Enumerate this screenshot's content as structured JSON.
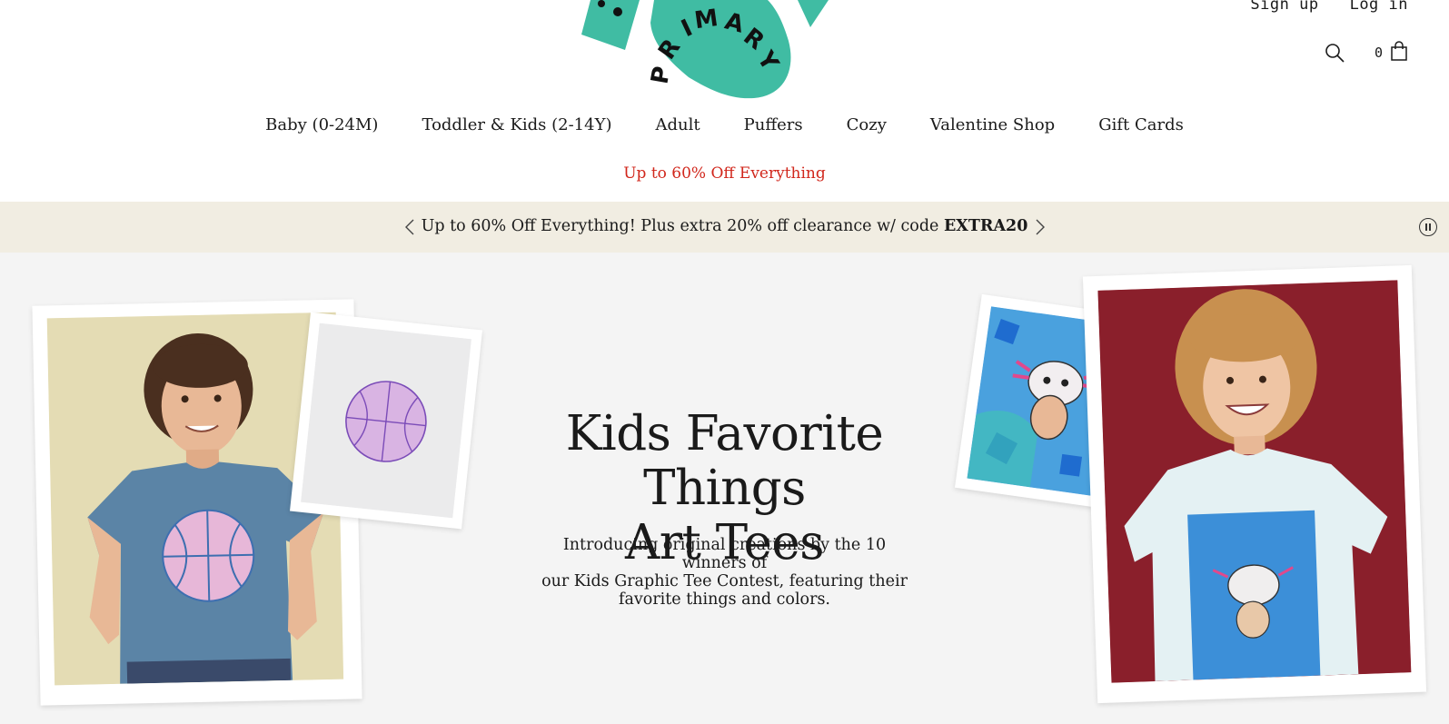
{
  "brand": {
    "logo_text": "PRIMARY",
    "logo_color": "#40bca3"
  },
  "account": {
    "signup": "Sign up",
    "login": "Log in"
  },
  "cart": {
    "count": "0"
  },
  "nav": [
    {
      "label": "Baby (0-24M)"
    },
    {
      "label": "Toddler & Kids (2-14Y)"
    },
    {
      "label": "Adult"
    },
    {
      "label": "Puffers"
    },
    {
      "label": "Cozy"
    },
    {
      "label": "Valentine Shop"
    },
    {
      "label": "Gift Cards"
    }
  ],
  "promo_link": "Up to 60% Off Everything",
  "announcement": {
    "text": "Up to 60% Off Everything! Plus extra 20% off clearance w/ code ",
    "code": "EXTRA20",
    "background": "#f1ede2"
  },
  "hero": {
    "title_line1": "Kids Favorite Things",
    "title_line2": "Art Tees",
    "subtitle_line1": "Introducing original creations by the 10 winners of",
    "subtitle_line2": "our Kids Graphic Tee Contest, featuring their",
    "subtitle_line3": "favorite things and colors.",
    "background": "#f4f4f4"
  },
  "colors": {
    "accent_red": "#d1271c",
    "text": "#1a1a1a"
  }
}
